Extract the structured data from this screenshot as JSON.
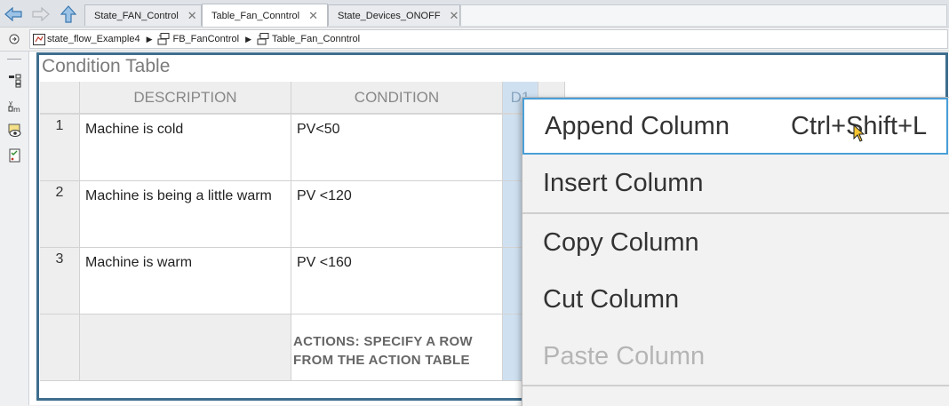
{
  "tabs": [
    {
      "label": "State_FAN_Control",
      "active": false
    },
    {
      "label": "Table_Fan_Conntrol",
      "active": true
    },
    {
      "label": "State_Devices_ONOFF",
      "active": false
    }
  ],
  "tab_close_glyph": "✕",
  "breadcrumb": [
    {
      "label": "state_flow_Example4",
      "icon": "chart-block-icon"
    },
    {
      "label": "FB_FanControl",
      "icon": "function-block-icon"
    },
    {
      "label": "Table_Fan_Conntrol",
      "icon": "function-block-icon"
    }
  ],
  "canvas": {
    "title": "Condition Table",
    "headers": {
      "description": "DESCRIPTION",
      "condition": "CONDITION",
      "decision": "D1"
    },
    "rows": [
      {
        "num": "1",
        "description": "Machine is cold",
        "condition": "PV<50"
      },
      {
        "num": "2",
        "description": "Machine is being a little warm",
        "condition": "PV <120"
      },
      {
        "num": "3",
        "description": "Machine is warm",
        "condition": "PV <160"
      }
    ],
    "actions_label": "ACTIONS: SPECIFY A ROW FROM THE ACTION TABLE"
  },
  "context_menu": {
    "items": [
      {
        "label": "Append Column",
        "shortcut": "Ctrl+Shift+L",
        "highlighted": true,
        "disabled": false
      },
      {
        "label": "Insert Column",
        "shortcut": "",
        "highlighted": false,
        "disabled": false
      },
      {
        "label": "Copy Column",
        "shortcut": "",
        "highlighted": false,
        "disabled": false
      },
      {
        "label": "Cut Column",
        "shortcut": "",
        "highlighted": false,
        "disabled": false
      },
      {
        "label": "Paste Column",
        "shortcut": "",
        "highlighted": false,
        "disabled": true
      }
    ]
  },
  "colors": {
    "accent": "#4a9fd8",
    "frame": "#3f6e8e",
    "decision_column": "#cfe1f1"
  }
}
